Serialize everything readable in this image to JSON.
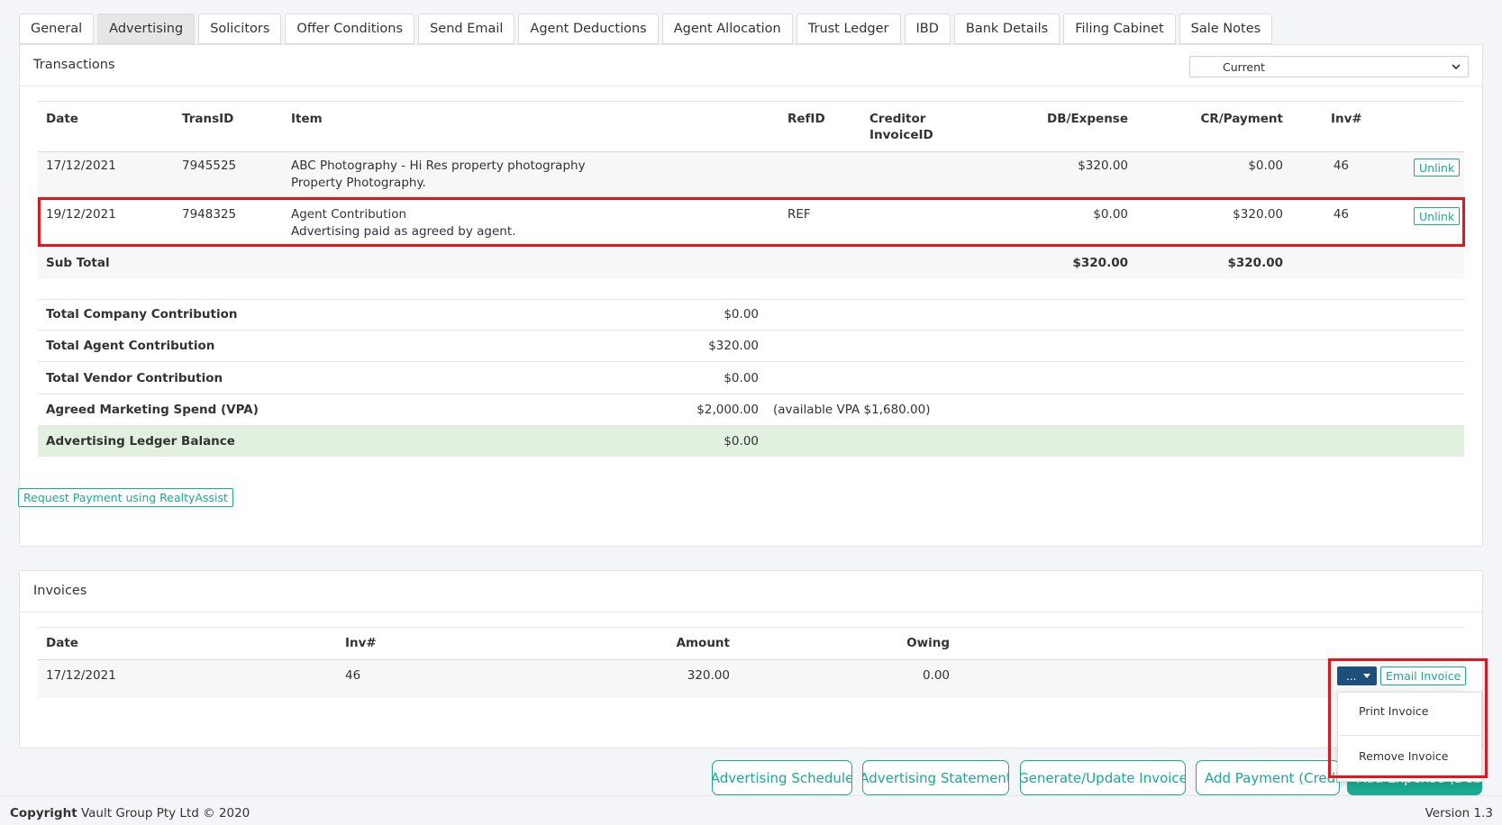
{
  "tabs": [
    "General",
    "Advertising",
    "Solicitors",
    "Offer Conditions",
    "Send Email",
    "Agent Deductions",
    "Agent Allocation",
    "Trust Ledger",
    "IBD",
    "Bank Details",
    "Filing Cabinet",
    "Sale Notes"
  ],
  "active_tab": "Advertising",
  "transactions": {
    "title": "Transactions",
    "filter_selected": "Current",
    "headers": {
      "date": "Date",
      "transid": "TransID",
      "item": "Item",
      "refid": "RefID",
      "creditor_line1": "Creditor",
      "creditor_line2": "InvoiceID",
      "db": "DB/Expense",
      "cr": "CR/Payment",
      "inv": "Inv#"
    },
    "rows": [
      {
        "date": "17/12/2021",
        "transid": "7945525",
        "item_title": "ABC Photography - Hi Res property photography",
        "item_desc": "Property Photography.",
        "refid": "",
        "db": "$320.00",
        "cr": "$0.00",
        "inv": "46",
        "action": "Unlink"
      },
      {
        "date": "19/12/2021",
        "transid": "7948325",
        "item_title": "Agent Contribution",
        "item_desc": "Advertising paid as agreed by agent.",
        "refid": "REF",
        "db": "$0.00",
        "cr": "$320.00",
        "inv": "46",
        "action": "Unlink"
      }
    ],
    "subtotal": {
      "label": "Sub Total",
      "db": "$320.00",
      "cr": "$320.00"
    },
    "summary": [
      {
        "label": "Total Company Contribution",
        "value": "$0.00",
        "note": ""
      },
      {
        "label": "Total Agent Contribution",
        "value": "$320.00",
        "note": ""
      },
      {
        "label": "Total Vendor Contribution",
        "value": "$0.00",
        "note": ""
      },
      {
        "label": "Agreed Marketing Spend (VPA)",
        "value": "$2,000.00",
        "note": "(available VPA $1,680.00)"
      },
      {
        "label": "Advertising Ledger Balance",
        "value": "$0.00",
        "note": ""
      }
    ],
    "request_button": "Request Payment using RealtyAssist"
  },
  "invoices": {
    "title": "Invoices",
    "headers": {
      "date": "Date",
      "inv": "Inv#",
      "amount": "Amount",
      "owing": "Owing"
    },
    "rows": [
      {
        "date": "17/12/2021",
        "inv": "46",
        "amount": "320.00",
        "owing": "0.00"
      }
    ],
    "more_button": "...",
    "email_button": "Email Invoice",
    "dropdown": [
      "Print Invoice",
      "Remove Invoice"
    ]
  },
  "actions": [
    "Advertising Schedule",
    "Advertising Statement",
    "Generate/Update Invoice",
    "Add Payment (Credit)",
    "Add Expense (Debit)"
  ],
  "footer": {
    "copyright_label": "Copyright",
    "copyright_text": "Vault Group Pty Ltd © 2020",
    "version": "Version 1.3"
  },
  "colors": {
    "accent": "#1aaa8f",
    "highlight": "#e8141b",
    "dark_button": "#1c4f7c",
    "balance_row": "#e2f1df"
  }
}
